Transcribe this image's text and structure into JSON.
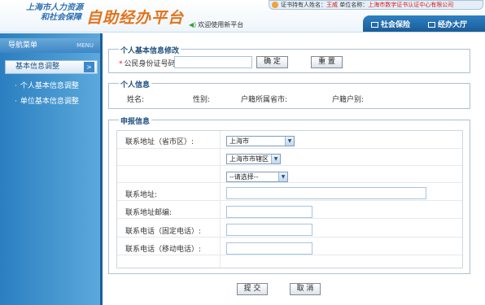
{
  "header": {
    "logo_line1": "上海市人力资源",
    "logo_line2": "和社会保障",
    "brand": "自助经办平台",
    "welcome": "欢迎使用新平台",
    "cert_prefix": "证书持有人姓名：",
    "cert_name": "王威",
    "unit_prefix": "单位名称：",
    "unit_name": "上海市数字证书认证中心有限公司",
    "nav": [
      {
        "label": "社会保险"
      },
      {
        "label": "经办大厅"
      }
    ]
  },
  "sidebar": {
    "title": "导航菜单",
    "menu_tag": "MENU",
    "group": "基本信息调整",
    "items": [
      {
        "label": "个人基本信息调整"
      },
      {
        "label": "单位基本信息调整"
      }
    ]
  },
  "section_modify": {
    "title": "个人基本信息修改",
    "id_label": "公民身份证号码:",
    "id_value": "",
    "confirm_btn": "确 定",
    "reset_btn": "重 置"
  },
  "section_personal": {
    "title": "个人信息",
    "name_label": "姓名:",
    "gender_label": "性别:",
    "hukou_city_label": "户籍所属省市:",
    "hukou_type_label": "户籍户别:"
  },
  "section_declare": {
    "title": "申报信息",
    "address_region_label": "联系地址（省市区）:",
    "province": "上海市",
    "district": "上海市市辖区",
    "county": "--请选择--",
    "address_label": "联系地址:",
    "postcode_label": "联系地址邮编:",
    "phone_fixed_label": "联系电话（固定电话）:",
    "phone_mobile_label": "联系电话（移动电话）:"
  },
  "actions": {
    "submit": "提 交",
    "cancel": "取 消"
  },
  "colors": {
    "brand": "#e2741b",
    "sidebar": "#2b7fc0",
    "required": "#e02020"
  }
}
